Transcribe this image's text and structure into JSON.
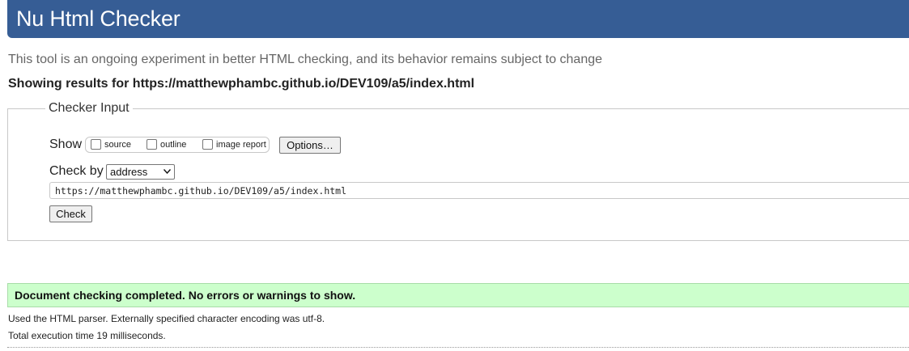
{
  "header": {
    "title": "Nu Html Checker"
  },
  "tagline": "This tool is an ongoing experiment in better HTML checking, and its behavior remains subject to change",
  "showing": {
    "prefix": "Showing results for",
    "url": "https://matthewphambc.github.io/DEV109/a5/index.html"
  },
  "checker_input": {
    "legend": "Checker Input",
    "show_label": "Show",
    "checkboxes": [
      {
        "label": "source",
        "checked": false
      },
      {
        "label": "outline",
        "checked": false
      },
      {
        "label": "image report",
        "checked": false
      }
    ],
    "options_button": "Options…",
    "check_by_label": "Check by",
    "check_by_selected": "address",
    "url_value": "https://matthewphambc.github.io/DEV109/a5/index.html",
    "check_button": "Check"
  },
  "results": {
    "success_message": "Document checking completed. No errors or warnings to show.",
    "parser_info": "Used the HTML parser. Externally specified character encoding was utf-8.",
    "execution_time": "Total execution time 19 milliseconds."
  },
  "colors": {
    "header_bg": "#365d95",
    "success_bg": "#ccffcc"
  }
}
